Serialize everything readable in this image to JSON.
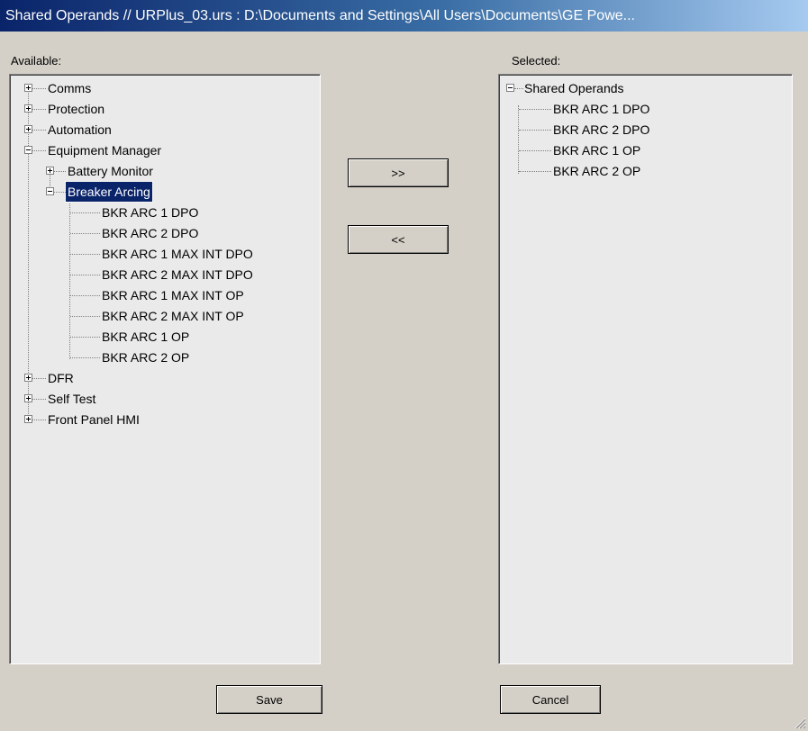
{
  "window": {
    "title": "Shared Operands // URPlus_03.urs : D:\\Documents and Settings\\All Users\\Documents\\GE Powe..."
  },
  "available": {
    "label": "Available:",
    "tree": {
      "comms": "Comms",
      "protection": "Protection",
      "automation": "Automation",
      "equipment_manager": "Equipment Manager",
      "battery_monitor": "Battery Monitor",
      "breaker_arcing": "Breaker Arcing",
      "breaker_arcing_children": [
        "BKR ARC 1 DPO",
        "BKR ARC 2 DPO",
        "BKR ARC 1 MAX INT DPO",
        "BKR ARC 2 MAX INT DPO",
        "BKR ARC 1 MAX INT OP",
        "BKR ARC 2 MAX INT OP",
        "BKR ARC 1 OP",
        "BKR ARC 2 OP"
      ],
      "dfr": "DFR",
      "self_test": "Self Test",
      "front_panel_hmi": "Front Panel HMI"
    }
  },
  "selected": {
    "label": "Selected:",
    "tree": {
      "root": "Shared Operands",
      "children": [
        "BKR ARC 1 DPO",
        "BKR ARC 2 DPO",
        "BKR ARC 1 OP",
        "BKR ARC 2 OP"
      ]
    }
  },
  "buttons": {
    "add": ">>",
    "remove": "<<",
    "save": "Save",
    "cancel": "Cancel"
  }
}
